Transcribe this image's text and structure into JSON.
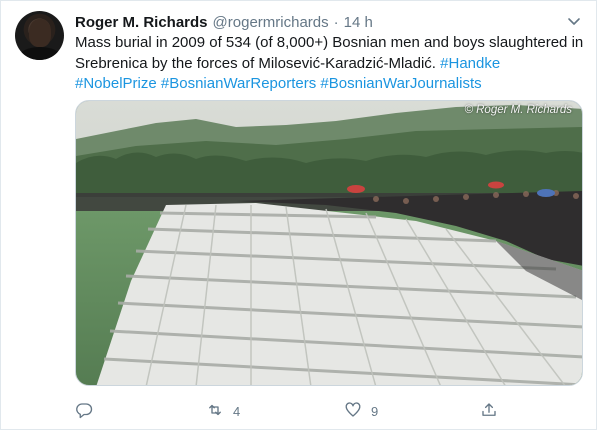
{
  "tweet": {
    "author_name": "Roger M. Richards",
    "handle": "@rogermrichards",
    "separator": "·",
    "time": "14 h",
    "text_plain": "Mass burial in 2009 of 534 (of 8,000+) Bosnian men and boys slaughtered in Srebrenica by the forces of Milosević-Karadzić-Mladić.",
    "hashtags": [
      "#Handke",
      "#NobelPrize",
      "#BosnianWarReporters",
      "#BosnianWarJournalists"
    ],
    "photo_credit": "© Roger M. Richards"
  },
  "actions": {
    "reply_count": "",
    "retweet_count": "4",
    "like_count": "9",
    "share_count": ""
  },
  "icons": {
    "avatar": "avatar",
    "more": "chevron-down-icon",
    "reply": "reply-icon",
    "retweet": "retweet-icon",
    "like": "heart-icon",
    "share": "share-icon"
  },
  "colors": {
    "text": "#14171a",
    "secondary": "#657786",
    "link": "#1b95e0",
    "border": "#e1e8ed"
  }
}
